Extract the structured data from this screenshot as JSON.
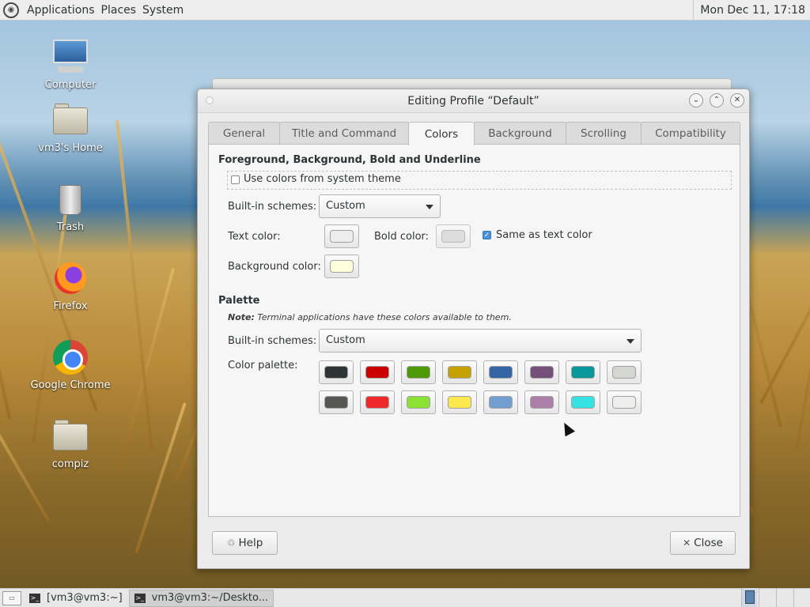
{
  "top_panel": {
    "menus": [
      "Applications",
      "Places",
      "System"
    ],
    "clock": "Mon Dec 11, 17:18"
  },
  "desktop_icons": [
    "Computer",
    "vm3's Home",
    "Trash",
    "Firefox",
    "Google Chrome",
    "compiz"
  ],
  "dialog": {
    "title": "Editing Profile “Default”",
    "tabs": [
      "General",
      "Title and Command",
      "Colors",
      "Background",
      "Scrolling",
      "Compatibility"
    ],
    "active_tab": "Colors",
    "fg_section": {
      "heading": "Foreground, Background, Bold and Underline",
      "use_system_theme_label": "Use colors from system theme",
      "use_system_theme_checked": false,
      "builtin_label": "Built-in schemes:",
      "builtin_value": "Custom",
      "text_color_label": "Text color:",
      "text_color": "#ededed",
      "bold_color_label": "Bold color:",
      "bold_color": "#d3d3d3",
      "same_as_text_label": "Same as text color",
      "same_as_text_checked": true,
      "bg_color_label": "Background color:",
      "bg_color": "#ffffdd"
    },
    "palette_section": {
      "heading": "Palette",
      "note_bold": "Note:",
      "note_text": " Terminal applications have these colors available to them.",
      "builtin_label": "Built-in schemes:",
      "builtin_value": "Custom",
      "palette_label": "Color palette:",
      "colors": [
        "#2e3436",
        "#cc0000",
        "#4e9a06",
        "#c4a000",
        "#3465a4",
        "#75507b",
        "#06989a",
        "#d3d7cf",
        "#555753",
        "#ef2929",
        "#8ae234",
        "#fce94f",
        "#729fcf",
        "#ad7fa8",
        "#34e2e2",
        "#eeeeec"
      ]
    },
    "help_label": "Help",
    "close_label": "Close"
  },
  "taskbar": {
    "items": [
      "[vm3@vm3:~]",
      "vm3@vm3:~/Deskto..."
    ]
  }
}
